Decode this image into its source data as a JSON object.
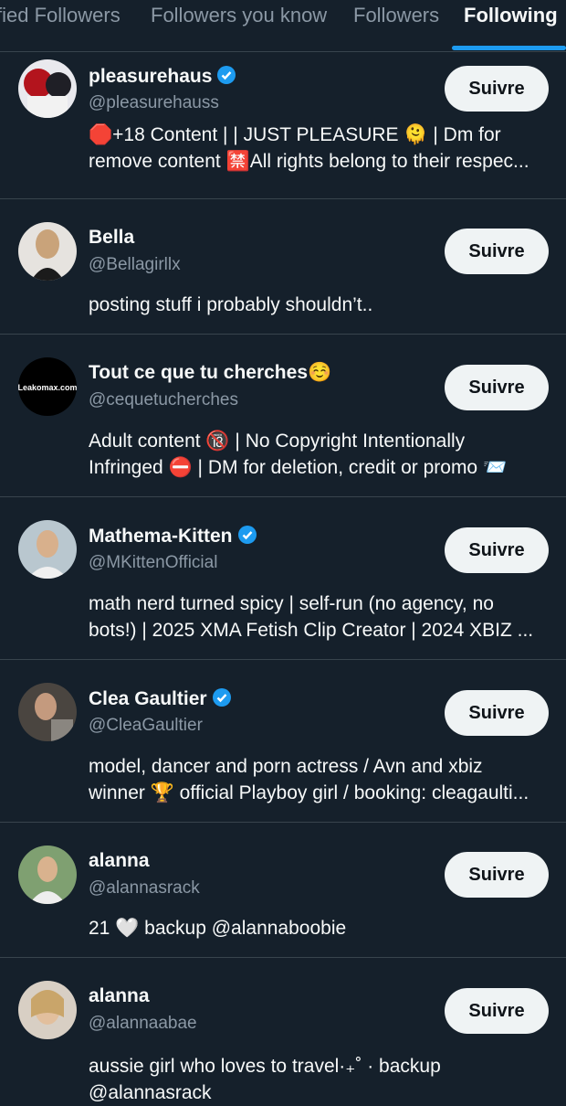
{
  "tabs": [
    {
      "label": "fied Followers"
    },
    {
      "label": "Followers you know"
    },
    {
      "label": "Followers"
    },
    {
      "label": "Following",
      "active": true
    }
  ],
  "accent_color": "#1d9bf0",
  "users": [
    {
      "name": "pleasurehaus",
      "verified": true,
      "handle": "@pleasurehauss",
      "bio": [
        "🛑+18 Content | | JUST PLEASURE 🫠 | Dm for",
        "remove content 🈲All rights belong to their respec..."
      ],
      "follow_label": "Suivre"
    },
    {
      "name": "Bella",
      "verified": false,
      "handle": "@Bellagirllx",
      "bio": [
        "posting stuff i probably shouldn’t.."
      ],
      "follow_label": "Suivre"
    },
    {
      "name": "Tout ce que tu cherches☺️",
      "verified": false,
      "handle": "@cequetucherches",
      "bio": [
        "Adult content 🔞 | No Copyright Intentionally",
        "Infringed ⛔ | DM for deletion, credit or promo 📨"
      ],
      "avatar_text": "Leakomax.com",
      "follow_label": "Suivre"
    },
    {
      "name": "Mathema-Kitten",
      "verified": true,
      "handle": "@MKittenOfficial",
      "bio": [
        "math nerd turned spicy | self-run (no agency, no",
        "bots!) | 2025 XMA Fetish Clip Creator | 2024 XBIZ ..."
      ],
      "follow_label": "Suivre"
    },
    {
      "name": "Clea Gaultier",
      "verified": true,
      "handle": "@CleaGaultier",
      "bio": [
        "model, dancer and porn actress / Avn and xbiz",
        "winner 🏆 official Playboy girl / booking: cleagaulti..."
      ],
      "follow_label": "Suivre"
    },
    {
      "name": "alanna",
      "verified": false,
      "handle": "@alannasrack",
      "bio": [
        "21 🤍 backup @alannaboobie"
      ],
      "follow_label": "Suivre"
    },
    {
      "name": "alanna",
      "verified": false,
      "handle": "@alannaabae",
      "bio": [
        "aussie girl who loves to travel·₊˚ · backup",
        "@alannasrack"
      ],
      "follow_label": "Suivre"
    }
  ]
}
